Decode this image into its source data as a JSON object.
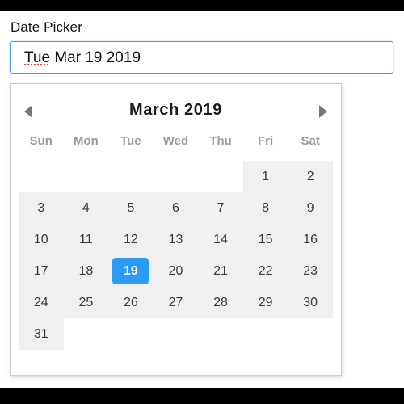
{
  "field": {
    "label": "Date Picker",
    "value": "Tue Mar 19 2019",
    "misspelled_token": "Tue",
    "value_rest": " Mar 19 2019"
  },
  "calendar": {
    "prev_arrow": "previous-month",
    "next_arrow": "next-month",
    "title": "March 2019",
    "month": "March",
    "year": "2019",
    "weekdays": [
      "Sun",
      "Mon",
      "Tue",
      "Wed",
      "Thu",
      "Fri",
      "Sat"
    ],
    "selected_day": "19",
    "weeks": [
      [
        "",
        "",
        "",
        "",
        "",
        "1",
        "2"
      ],
      [
        "3",
        "4",
        "5",
        "6",
        "7",
        "8",
        "9"
      ],
      [
        "10",
        "11",
        "12",
        "13",
        "14",
        "15",
        "16"
      ],
      [
        "17",
        "18",
        "19",
        "20",
        "21",
        "22",
        "23"
      ],
      [
        "24",
        "25",
        "26",
        "27",
        "28",
        "29",
        "30"
      ],
      [
        "31",
        "",
        "",
        "",
        "",
        "",
        ""
      ]
    ]
  },
  "colors": {
    "accent": "#2b9bf4",
    "focus_border": "#5b9dd9",
    "cell_background": "#f0f0f0",
    "weekday_text": "#9b9b9b",
    "day_text": "#3a3a3a",
    "arrow": "#777777",
    "spellcheck_underline": "#e8452c"
  }
}
